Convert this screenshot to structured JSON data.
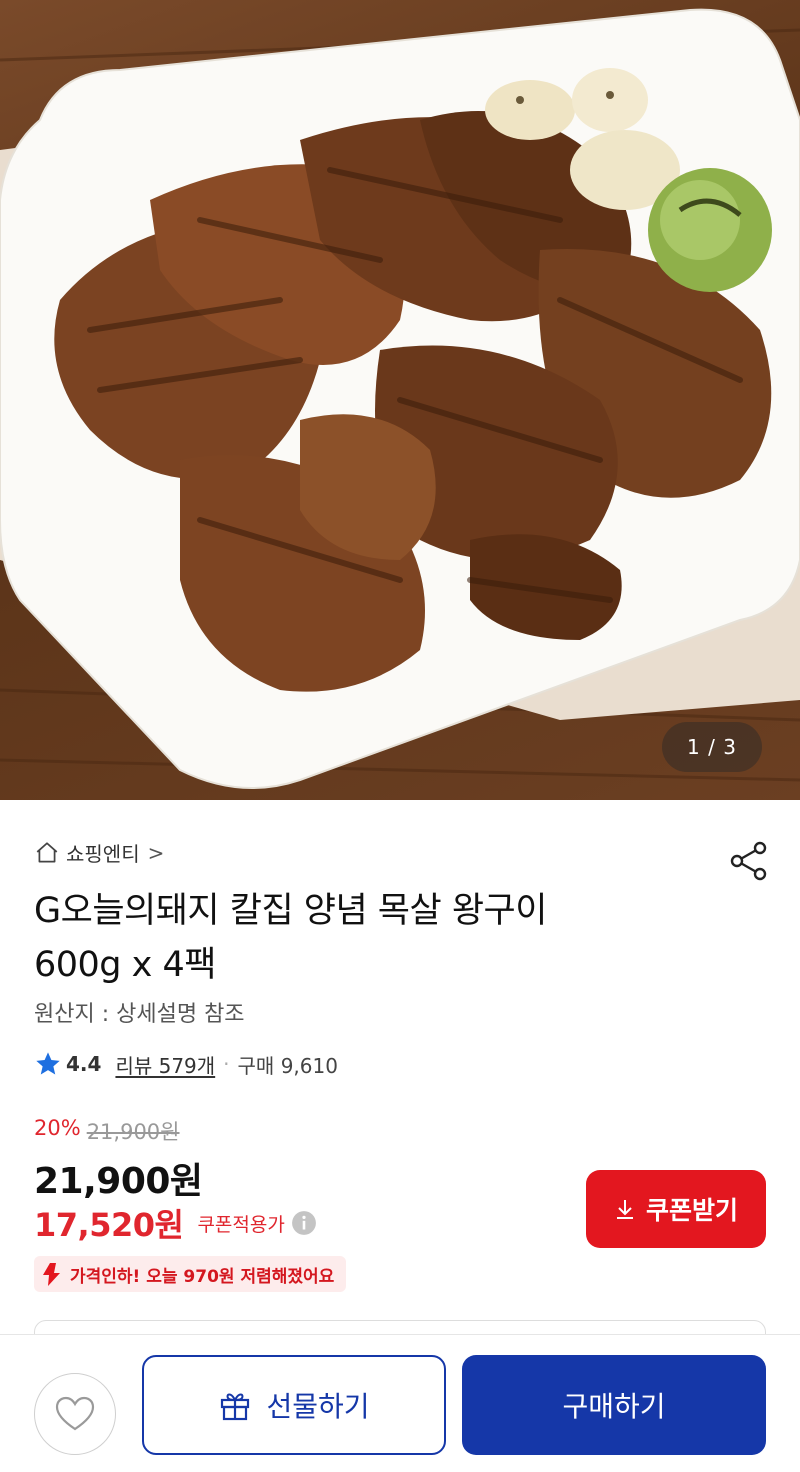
{
  "hero": {
    "image_label": "grilled pork neck on white plate",
    "counter": "1 / 3"
  },
  "store": {
    "name": "쇼핑엔티",
    "chevron": ">"
  },
  "product": {
    "title_line1": "G오늘의돼지 칼집 양념 목살 왕구이",
    "title_line2": "600g x 4팩",
    "origin": "원산지 : 상세설명 참조"
  },
  "rating": {
    "score": "4.4",
    "review_text": "리뷰 579개",
    "separator": "·",
    "purchase_text": "구매 9,610"
  },
  "pricing": {
    "discount_pct": "20%",
    "original_price": "21,900원",
    "sale_price": "21,900원",
    "coupon_price": "17,520원",
    "coupon_label": "쿠폰적용가",
    "drop_notice": "가격인하! 오늘 970원 저렴해졌어요"
  },
  "buttons": {
    "coupon": "쿠폰받기",
    "gift": "선물하기",
    "buy": "구매하기"
  },
  "colors": {
    "accent_red": "#e3171f",
    "brand_blue": "#1537a8",
    "star_blue": "#1e6fe0"
  }
}
